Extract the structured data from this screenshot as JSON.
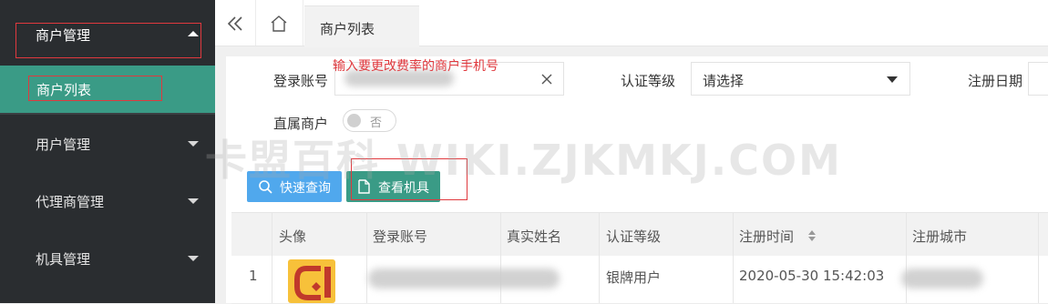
{
  "sidebar": {
    "group_merchant": "商户管理",
    "active_item": "商户列表",
    "items": [
      {
        "label": "用户管理"
      },
      {
        "label": "代理商管理"
      },
      {
        "label": "机具管理"
      }
    ]
  },
  "tabs": {
    "active": "商户列表"
  },
  "filters": {
    "login_account_label": "登录账号",
    "annotation": "输入要更改费率的商户手机号",
    "cert_level_label": "认证等级",
    "cert_level_value": "请选择",
    "reg_date_label": "注册日期",
    "direct_label": "直属商户",
    "direct_toggle_text": "否"
  },
  "buttons": {
    "quick_query": "快速查询",
    "view_devices": "查看机具"
  },
  "table": {
    "headers": [
      "头像",
      "登录账号",
      "真实姓名",
      "认证等级",
      "注册时间",
      "注册城市"
    ],
    "rows": [
      {
        "index": "1",
        "cert_level": "银牌用户",
        "reg_time": "2020-05-30 15:42:03"
      }
    ]
  },
  "watermark": "卡盟百科  WIKI.ZJKMKJ.COM",
  "colors": {
    "sidebar_bg": "#2a2d30",
    "active_green": "#3a9b86",
    "button_blue": "#50a8ed",
    "annotation_red": "#e0393e"
  }
}
